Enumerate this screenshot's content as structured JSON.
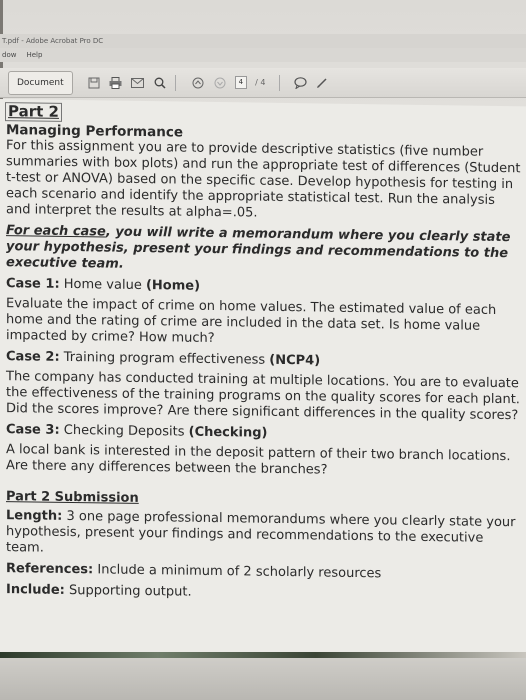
{
  "window": {
    "title": "T.pdf - Adobe Acrobat Pro DC",
    "menu": [
      "dow",
      "Help"
    ]
  },
  "toolbar": {
    "tab_label": "Document",
    "page_current": "4",
    "page_total": "/ 4"
  },
  "doc": {
    "part_title": "Part 2",
    "subtitle": "Managing Performance",
    "intro": "For this assignment you are to provide descriptive statistics (five number summaries with box plots) and run the appropriate test of differences (Student t-test or ANOVA) based on the specific case. Develop hypothesis for testing in each scenario and identify the appropriate statistical test. Run the analysis and interpret the results at alpha=.05.",
    "memo_lead": "For each case",
    "memo_rest": ", you will write a memorandum where you clearly state your hypothesis, present your findings and recommendations to the executive team.",
    "case1_label": "Case 1:",
    "case1_name": "Home value",
    "case1_code": "(Home)",
    "case1_text": "Evaluate the impact of crime on home values. The estimated value of each home and the rating of crime are included in the data set. Is home value impacted by crime? How much?",
    "case2_label": "Case 2:",
    "case2_name": "Training program effectiveness",
    "case2_code": "(NCP4)",
    "case2_text": "The company has conducted training at multiple locations. You are to evaluate the effectiveness of the training programs on the quality scores for each plant. Did the scores improve? Are there significant differences in the quality scores?",
    "case3_label": "Case 3:",
    "case3_name": "Checking Deposits",
    "case3_code": "(Checking)",
    "case3_text": "A local bank is interested in the deposit pattern of their two branch locations. Are there any differences between the branches?",
    "submission_title": "Part 2 Submission",
    "length_label": "Length:",
    "length_text": "3 one page professional memorandums where you clearly state your hypothesis, present your findings and recommendations to the executive team.",
    "references_label": "References:",
    "references_text": "Include a minimum of 2 scholarly resources",
    "include_label": "Include:",
    "include_text": "Supporting output."
  }
}
